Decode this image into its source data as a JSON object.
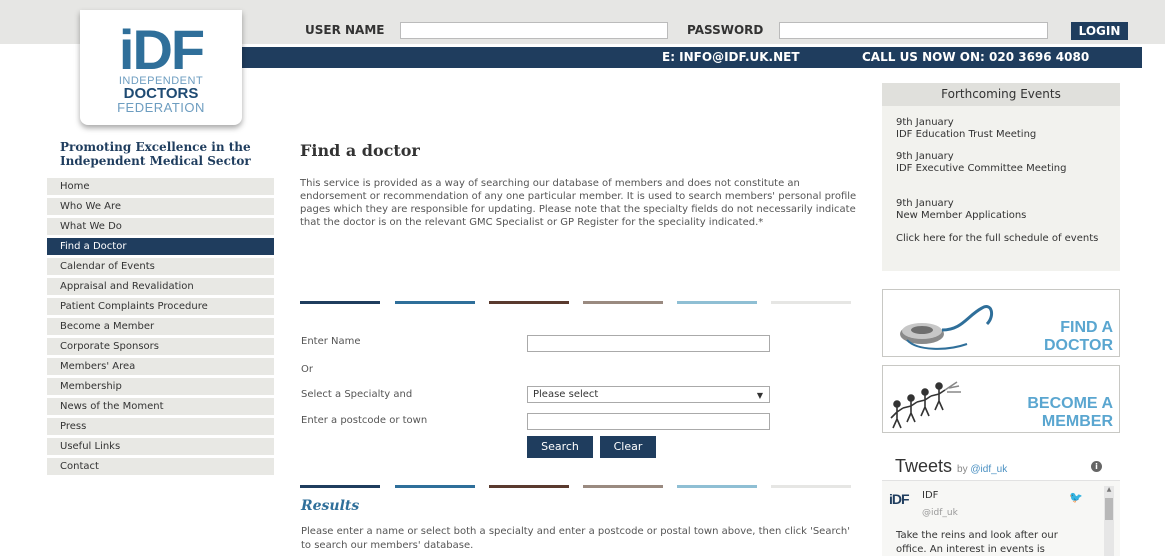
{
  "logo": {
    "mark": "iDF",
    "line1": "INDEPENDENT",
    "line2": "DOCTORS",
    "line3": "FEDERATION"
  },
  "login": {
    "username_label": "USER NAME",
    "password_label": "PASSWORD",
    "button_label": "LOGIN"
  },
  "contact": {
    "email": "E: INFO@IDF.UK.NET",
    "phone": "CALL US NOW ON: 020 3696 4080"
  },
  "tagline": "Promoting Excellence in the Independent Medical Sector",
  "nav": {
    "items": [
      {
        "label": "Home"
      },
      {
        "label": "Who We Are"
      },
      {
        "label": "What We Do"
      },
      {
        "label": "Find a Doctor"
      },
      {
        "label": "Calendar of Events"
      },
      {
        "label": "Appraisal and Revalidation"
      },
      {
        "label": "Patient Complaints Procedure"
      },
      {
        "label": "Become a Member"
      },
      {
        "label": "Corporate Sponsors"
      },
      {
        "label": "Members' Area"
      },
      {
        "label": "Membership"
      },
      {
        "label": "News of the Moment"
      },
      {
        "label": "Press"
      },
      {
        "label": "Useful Links"
      },
      {
        "label": "Contact"
      }
    ],
    "active_index": 3
  },
  "main": {
    "title": "Find a doctor",
    "intro": "This service is provided as a way of searching our database of members and does not constitute an endorsement or recommendation of any one particular member. It is used to search members' personal profile pages which they are responsible for updating. Please note that the specialty fields do not necessarily indicate that the doctor is on the relevant GMC Specialist or GP Register for the speciality indicated.*",
    "stripe_colors": [
      "#1f3d5e",
      "#2f6f9a",
      "#5a3a2e",
      "#9a8a80",
      "#8fbfd4",
      "#e6e6e4"
    ]
  },
  "form": {
    "name_label": "Enter Name",
    "name_value": "",
    "or_label": "Or",
    "specialty_label": "Select a Specialty and",
    "specialty_selected": "Please select",
    "postcode_label": "Enter a postcode or town",
    "postcode_value": "",
    "search_label": "Search",
    "clear_label": "Clear"
  },
  "results": {
    "title": "Results",
    "text": "Please enter a name or select both a specialty and enter a postcode or postal town above, then click 'Search' to search our members' database."
  },
  "events": {
    "heading": "Forthcoming Events",
    "items": [
      {
        "date": "9th January",
        "title": "IDF Education Trust Meeting"
      },
      {
        "date": "9th January",
        "title": "IDF Executive Committee Meeting"
      },
      {
        "date": "9th January",
        "title": "New Member Applications"
      }
    ],
    "link": "Click here for the full schedule of events"
  },
  "banners": {
    "find_l1": "FIND A",
    "find_l2": "DOCTOR",
    "become_l1": "BECOME A",
    "become_l2": "MEMBER"
  },
  "tweets": {
    "title": "Tweets",
    "by": "by",
    "handle_link": "@idf_uk",
    "info": "i",
    "avatar": "iDF",
    "name": "IDF",
    "handle": "@idf_uk",
    "text": "Take the reins and look after our office. An interest in events is"
  },
  "colors": {
    "navy": "#1f3d5e",
    "accent_blue": "#2f6f9a",
    "light_blue": "#5aa6d0",
    "panel_grey": "#e8e8e4"
  }
}
